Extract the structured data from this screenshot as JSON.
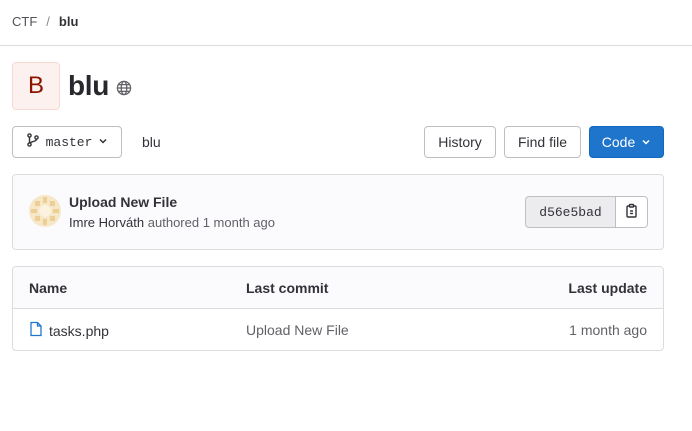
{
  "breadcrumb": {
    "group": "CTF",
    "separator": "/",
    "project": "blu"
  },
  "project": {
    "avatar_letter": "B",
    "name": "blu",
    "visibility_icon": "globe-icon"
  },
  "toolbar": {
    "branch": "master",
    "path": "blu",
    "history_label": "History",
    "find_file_label": "Find file",
    "code_label": "Code"
  },
  "last_commit": {
    "title": "Upload New File",
    "author": "Imre Horváth",
    "authored_text": "authored",
    "time": "1 month ago",
    "sha": "d56e5bad"
  },
  "files_table": {
    "headers": {
      "name": "Name",
      "last_commit": "Last commit",
      "last_update": "Last update"
    },
    "rows": [
      {
        "name": "tasks.php",
        "icon": "file-icon",
        "last_commit": "Upload New File",
        "last_update": "1 month ago"
      }
    ]
  },
  "colors": {
    "primary_button": "#1f75cb",
    "avatar_bg": "#fcf1ef",
    "avatar_text": "#8d1300",
    "file_icon": "#1f75cb"
  }
}
